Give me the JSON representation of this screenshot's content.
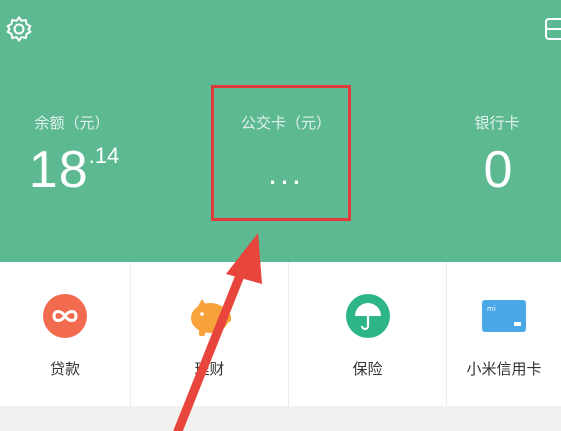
{
  "header": {
    "bg_color": "#5cb991",
    "settings_icon": "gear-icon",
    "card_icon": "card-icon",
    "stats": [
      {
        "label": "余额（元）",
        "value_int": "18",
        "value_dec": ".14"
      },
      {
        "label": "公交卡（元）",
        "value": "..."
      },
      {
        "label": "银行卡",
        "value": "0"
      }
    ]
  },
  "annotation": {
    "highlight_color": "#e03a3a"
  },
  "menu": {
    "items": [
      {
        "label": "贷款",
        "icon": "infinity-icon",
        "color": "#f26b4f"
      },
      {
        "label": "理财",
        "icon": "piggy-bank-icon",
        "color": "#f7a23a"
      },
      {
        "label": "保险",
        "icon": "umbrella-icon",
        "color": "#2eb489"
      },
      {
        "label": "小米信用卡",
        "icon": "credit-card-icon",
        "color": "#4aa8e8"
      }
    ]
  }
}
